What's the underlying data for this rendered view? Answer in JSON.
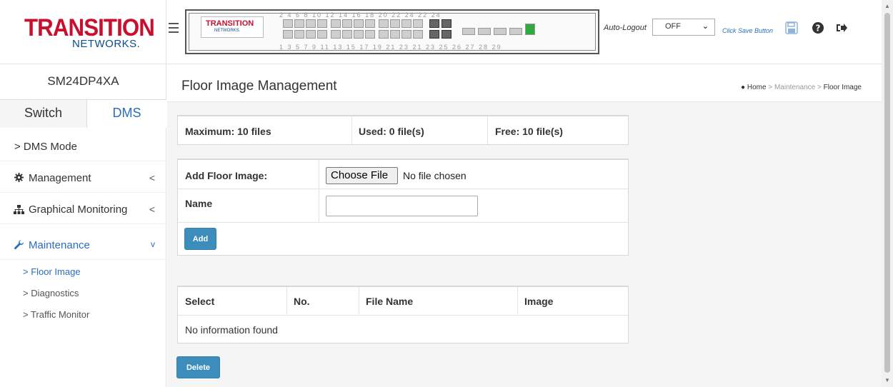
{
  "brand": {
    "name": "TRANSITION",
    "sub": "NETWORKS.",
    "panel_name": "TRANSITION",
    "panel_sub": "NETWORKS."
  },
  "header": {
    "autologout_label": "Auto-Logout",
    "autologout_value": "OFF",
    "save_label": "Click Save Button",
    "port_numbers_top": "2 4 6 8 10 12 14 16 18 20 22 24 22 24",
    "port_numbers_bottom": "1 3 5 7 9 11 13 15 17 19 21 23 21 23 25 26 27 28 29"
  },
  "sidebar": {
    "device_name": "SM24DP4XA",
    "tabs": [
      {
        "label": "Switch"
      },
      {
        "label": "DMS"
      }
    ],
    "items": [
      {
        "label": "> DMS Mode",
        "arrow": ""
      },
      {
        "label": "Management",
        "arrow": "<"
      },
      {
        "label": "Graphical Monitoring",
        "arrow": "<"
      },
      {
        "label": "Maintenance",
        "arrow": "v"
      }
    ],
    "subitems": [
      {
        "label": "> Floor Image"
      },
      {
        "label": "> Diagnostics"
      },
      {
        "label": "> Traffic Monitor"
      }
    ]
  },
  "page": {
    "title": "Floor Image Management",
    "breadcrumb": {
      "home": "Home",
      "sep": ">",
      "section": "Maintenance",
      "current": "Floor Image"
    }
  },
  "stats": {
    "maximum": "Maximum: 10 files",
    "used": "Used: 0 file(s)",
    "free": "Free: 10 file(s)"
  },
  "form": {
    "add_label": "Add Floor Image:",
    "choose_file": "Choose File",
    "no_file": "No file chosen",
    "name_label": "Name",
    "name_value": "",
    "add_button": "Add"
  },
  "table": {
    "headers": [
      "Select",
      "No.",
      "File Name",
      "Image"
    ],
    "empty": "No information found",
    "delete_button": "Delete"
  },
  "colors": {
    "accent": "#2a6ebb",
    "button": "#3c8dbc",
    "brand_red": "#c8102e",
    "brand_blue": "#0b4c8c"
  }
}
